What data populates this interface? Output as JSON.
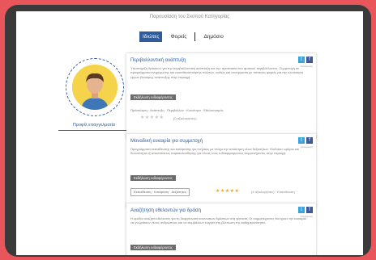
{
  "header": {
    "top_text": "Παρουσίαση του Σκοπού Κατηγορίας"
  },
  "tabs": [
    {
      "label": "Ιδιώτες",
      "active": true
    },
    {
      "label": "Φορείς",
      "active": false
    },
    {
      "label": "Δημόσιο",
      "active": false
    }
  ],
  "profile": {
    "link_label": "Προφίλ επαγγελματία"
  },
  "cards": [
    {
      "title": "Περιβαλλοντική ανάπτυξη",
      "twitter": "t",
      "facebook": "f",
      "brand": "Καταγραφή",
      "description": "Υποστήριξη δράσεων για την περιβαλλοντική ανάπτυξη και την προστασία του φυσικού περιβάλλοντος. Συμμετοχή σε προγράμματα ενημέρωσης και ευαισθητοποίησης πολιτών, καθώς και συνεργασία με τοπικούς φορείς για την υλοποίηση έργων βιώσιμης ανάπτυξης στην περιοχή.",
      "button": "Εκδήλωση ενδιαφέροντος",
      "meta": "Πρόσκληση · Ανάπτυξη · Περιβάλλον · Κοινότητα · Εθελοντισμός",
      "stars": "★★★★★",
      "rating_text": "(0 αξιολογήσεις)"
    },
    {
      "title": "Μοναδική ευκαιρία για συμμετοχή",
      "twitter": "t",
      "facebook": "f",
      "brand": "Καταγραφή",
      "description": "Προγράμματα εκπαίδευσης και κατάρτισης για ενήλικες με στόχο την απόκτηση νέων δεξιοτήτων. Ευέλικτο ωράριο και δυνατότητα εξ αποστάσεως παρακολούθησης για όλους τους ενδιαφερόμενους συμμετέχοντες στην περιοχή.",
      "button": "Εκδήλωση ενδιαφέροντος",
      "tag": "Εκπαίδευση · Κατάρτιση · Δεξιότητες",
      "stars": "★★★★★",
      "rating_text": "(4 αξιολογήσεις) · Εκπαίδευση"
    },
    {
      "title": "Αναζήτηση εθελοντών για δράση",
      "twitter": "t",
      "facebook": "f",
      "brand": "Καταγραφή",
      "description": "Η ομάδα αναζητά εθελοντές για τη διοργάνωση κοινωνικών δράσεων στη γειτονιά. Οι συμμετέχοντες θα έχουν την ευκαιρία να γνωρίσουν νέους ανθρώπους και να συμβάλουν ενεργά στη βελτίωση της καθημερινότητας.",
      "button": "Εκδήλωση ενδιαφέροντος"
    }
  ],
  "colors": {
    "accent": "#2e5d9f",
    "background": "#e8565c",
    "frame": "#3a3a3a"
  }
}
